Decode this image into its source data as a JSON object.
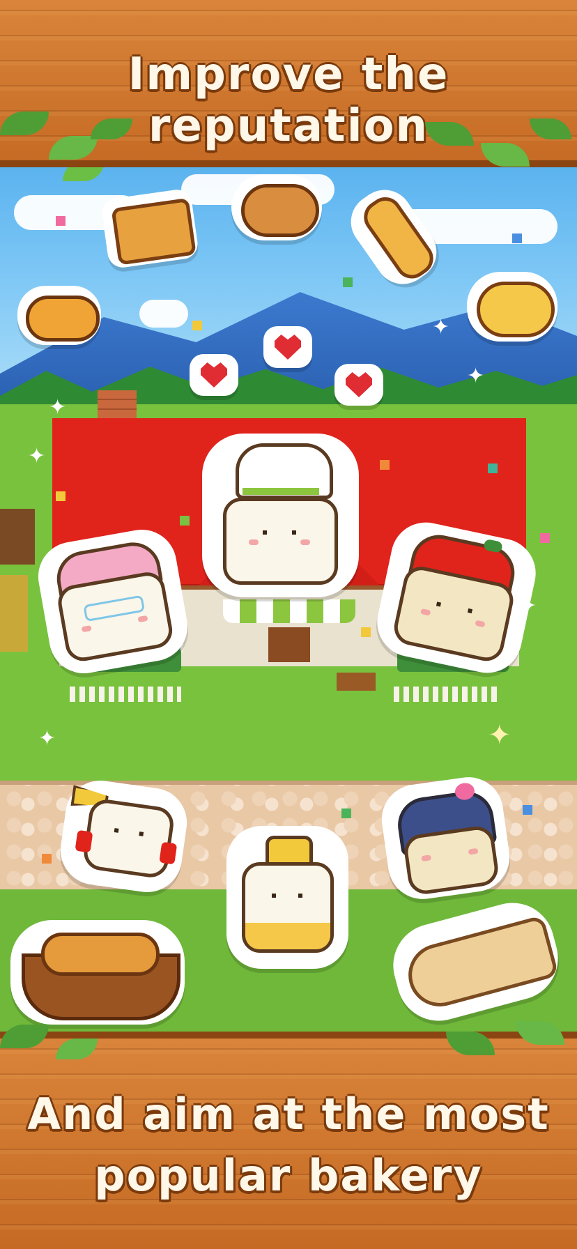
{
  "captions": {
    "top": "Improve the reputation",
    "bottom_line1": "And aim at the most",
    "bottom_line2": "popular bakery"
  },
  "colors": {
    "wood": "#d9843a",
    "caption_text": "#fff7e8",
    "caption_outline": "#7a3a0c",
    "roof": "#e0231b",
    "grass": "#79c23e",
    "sky": "#5bb3ef"
  },
  "icons": {
    "bread_items": [
      "square-loaf-icon",
      "round-bread-icon",
      "baguette-icon",
      "croissant-icon",
      "melon-bread-icon",
      "basket-bread-icon",
      "taiyaki-icon"
    ],
    "hearts": [
      "heart-icon",
      "heart-icon",
      "heart-icon"
    ],
    "characters": [
      "chef-hamster",
      "grandma-hamster",
      "apple-hat-hamster",
      "trumpet-hamster",
      "bell-hamster",
      "blue-hair-hamster"
    ]
  }
}
